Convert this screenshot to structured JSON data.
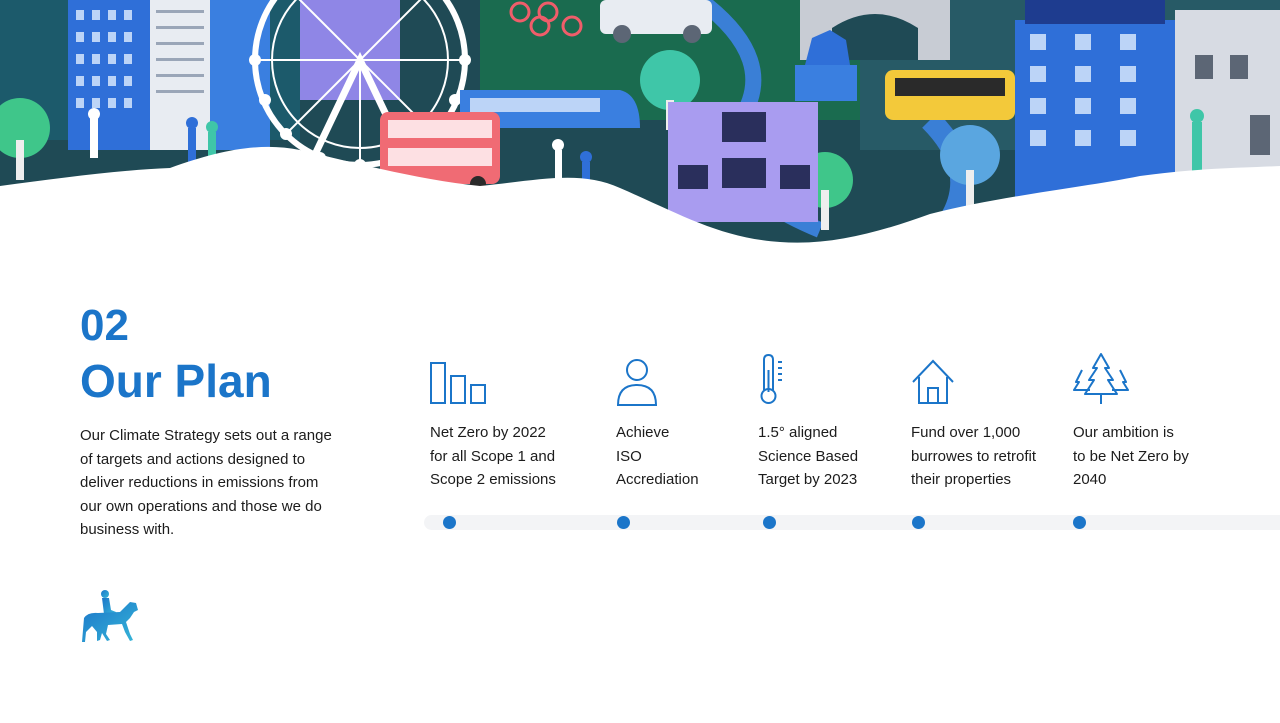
{
  "section": {
    "number": "02",
    "title": "Our Plan",
    "intro_lines": [
      "Our Climate Strategy sets out a range",
      "of targets and actions designed to",
      "deliver reductions in emissions from",
      "our own operations and those we do",
      "business with."
    ]
  },
  "targets": [
    {
      "icon": "bar-chart-icon",
      "lines": [
        "Net Zero by 2022",
        "for all Scope 1 and",
        "Scope 2 emissions"
      ]
    },
    {
      "icon": "person-icon",
      "lines": [
        "Achieve",
        "ISO",
        "Accrediation"
      ]
    },
    {
      "icon": "thermometer-icon",
      "lines": [
        "1.5° aligned",
        "Science Based",
        "Target by 2023"
      ]
    },
    {
      "icon": "house-icon",
      "lines": [
        "Fund over 1,000",
        "burrowes to retrofit",
        "their properties"
      ]
    },
    {
      "icon": "trees-icon",
      "lines": [
        "Our ambition is",
        "to be Net Zero by",
        "2040"
      ]
    }
  ],
  "colors": {
    "accent": "#1b75c9",
    "text": "#1c1c1c",
    "track": "#f3f4f6"
  },
  "banner_icon": "papercraft-city-illustration",
  "logo_icon": "horse-and-rider-logo"
}
